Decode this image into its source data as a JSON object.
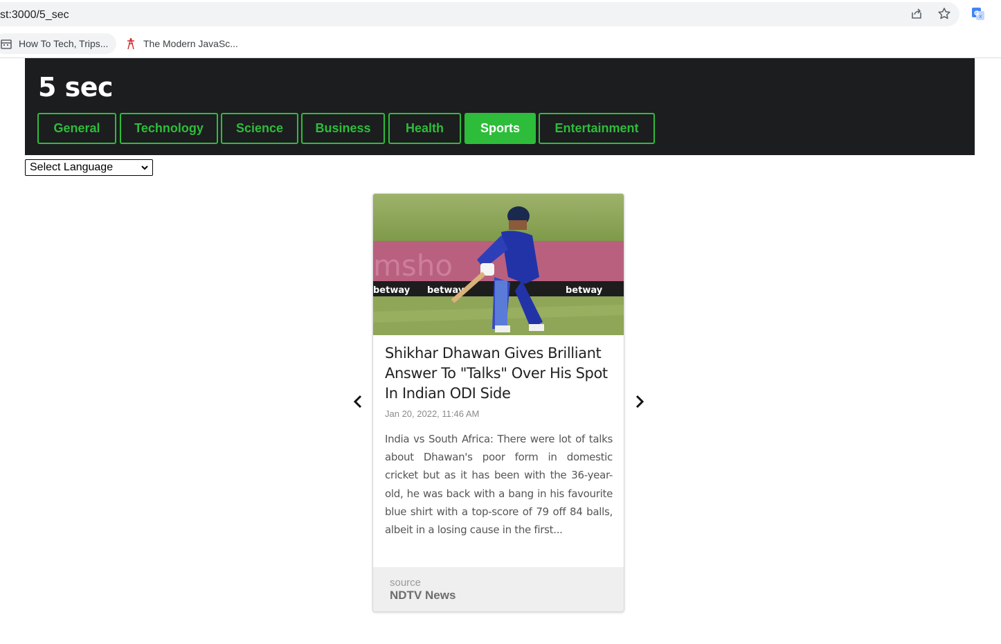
{
  "browser": {
    "url": "st:3000/5_sec",
    "icons": [
      "share-icon",
      "star-icon",
      "google-translate-icon"
    ],
    "bookmarks": [
      {
        "label": "How To Tech, Trips...",
        "icon": "calendar-icon"
      },
      {
        "label": "The Modern JavaSc...",
        "icon": "modern-js-icon"
      }
    ]
  },
  "app": {
    "title": "5 sec",
    "categories": [
      {
        "label": "General",
        "active": false
      },
      {
        "label": "Technology",
        "active": false
      },
      {
        "label": "Science",
        "active": false
      },
      {
        "label": "Business",
        "active": false
      },
      {
        "label": "Health",
        "active": false
      },
      {
        "label": "Sports",
        "active": true
      },
      {
        "label": "Entertainment",
        "active": false
      }
    ],
    "accent_color": "#2dbd3a",
    "header_bg": "#1c1d1f"
  },
  "language_select": {
    "selected": "Select Language"
  },
  "article": {
    "title": "Shikhar Dhawan Gives Brilliant Answer To \"Talks\" Over His Spot In Indian ODI Side",
    "date": "Jan 20, 2022, 11:46 AM",
    "description": "India vs South Africa: There were lot of talks about Dhawan's poor form in domestic cricket but as it has been with the 36-year-old, he was back with a bang in his favourite blue shirt with a top-score of 79 off 84 balls, albeit in a losing cause in the first...",
    "source_label": "source",
    "source_name": "NDTV News",
    "image": {
      "boards": [
        "betway",
        "betway",
        "betway"
      ],
      "banner": "msho"
    }
  }
}
